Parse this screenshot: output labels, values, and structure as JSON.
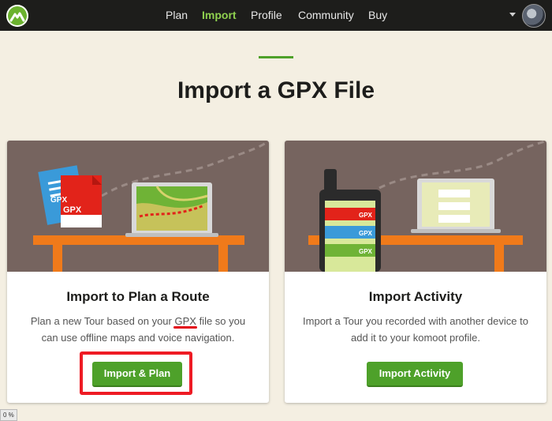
{
  "nav": {
    "items": [
      {
        "label": "Plan",
        "active": false
      },
      {
        "label": "Import",
        "active": true
      },
      {
        "label": "Profile",
        "active": false
      },
      {
        "label": "Community",
        "active": false
      },
      {
        "label": "Buy",
        "active": false
      }
    ]
  },
  "page": {
    "title": "Import a GPX File"
  },
  "cards": [
    {
      "title": "Import to Plan a Route",
      "desc_before": "Plan a new Tour based on your ",
      "desc_highlight": "GPX",
      "desc_after": " file so you can use offline maps and voice navigation.",
      "button": "Import & Plan",
      "file_badges": [
        "GPX",
        "GPX"
      ]
    },
    {
      "title": "Import Activity",
      "desc": "Import a Tour you recorded with another device to add it to your komoot profile.",
      "button": "Import Activity",
      "phone_badges": [
        "GPX",
        "GPX",
        "GPX"
      ]
    }
  ],
  "status": {
    "zoom": "0 %"
  },
  "colors": {
    "brand_green": "#4ea12a",
    "nav_active": "#8fd14f",
    "highlight_red": "#ee1b24",
    "illus_bg": "#76645f"
  }
}
